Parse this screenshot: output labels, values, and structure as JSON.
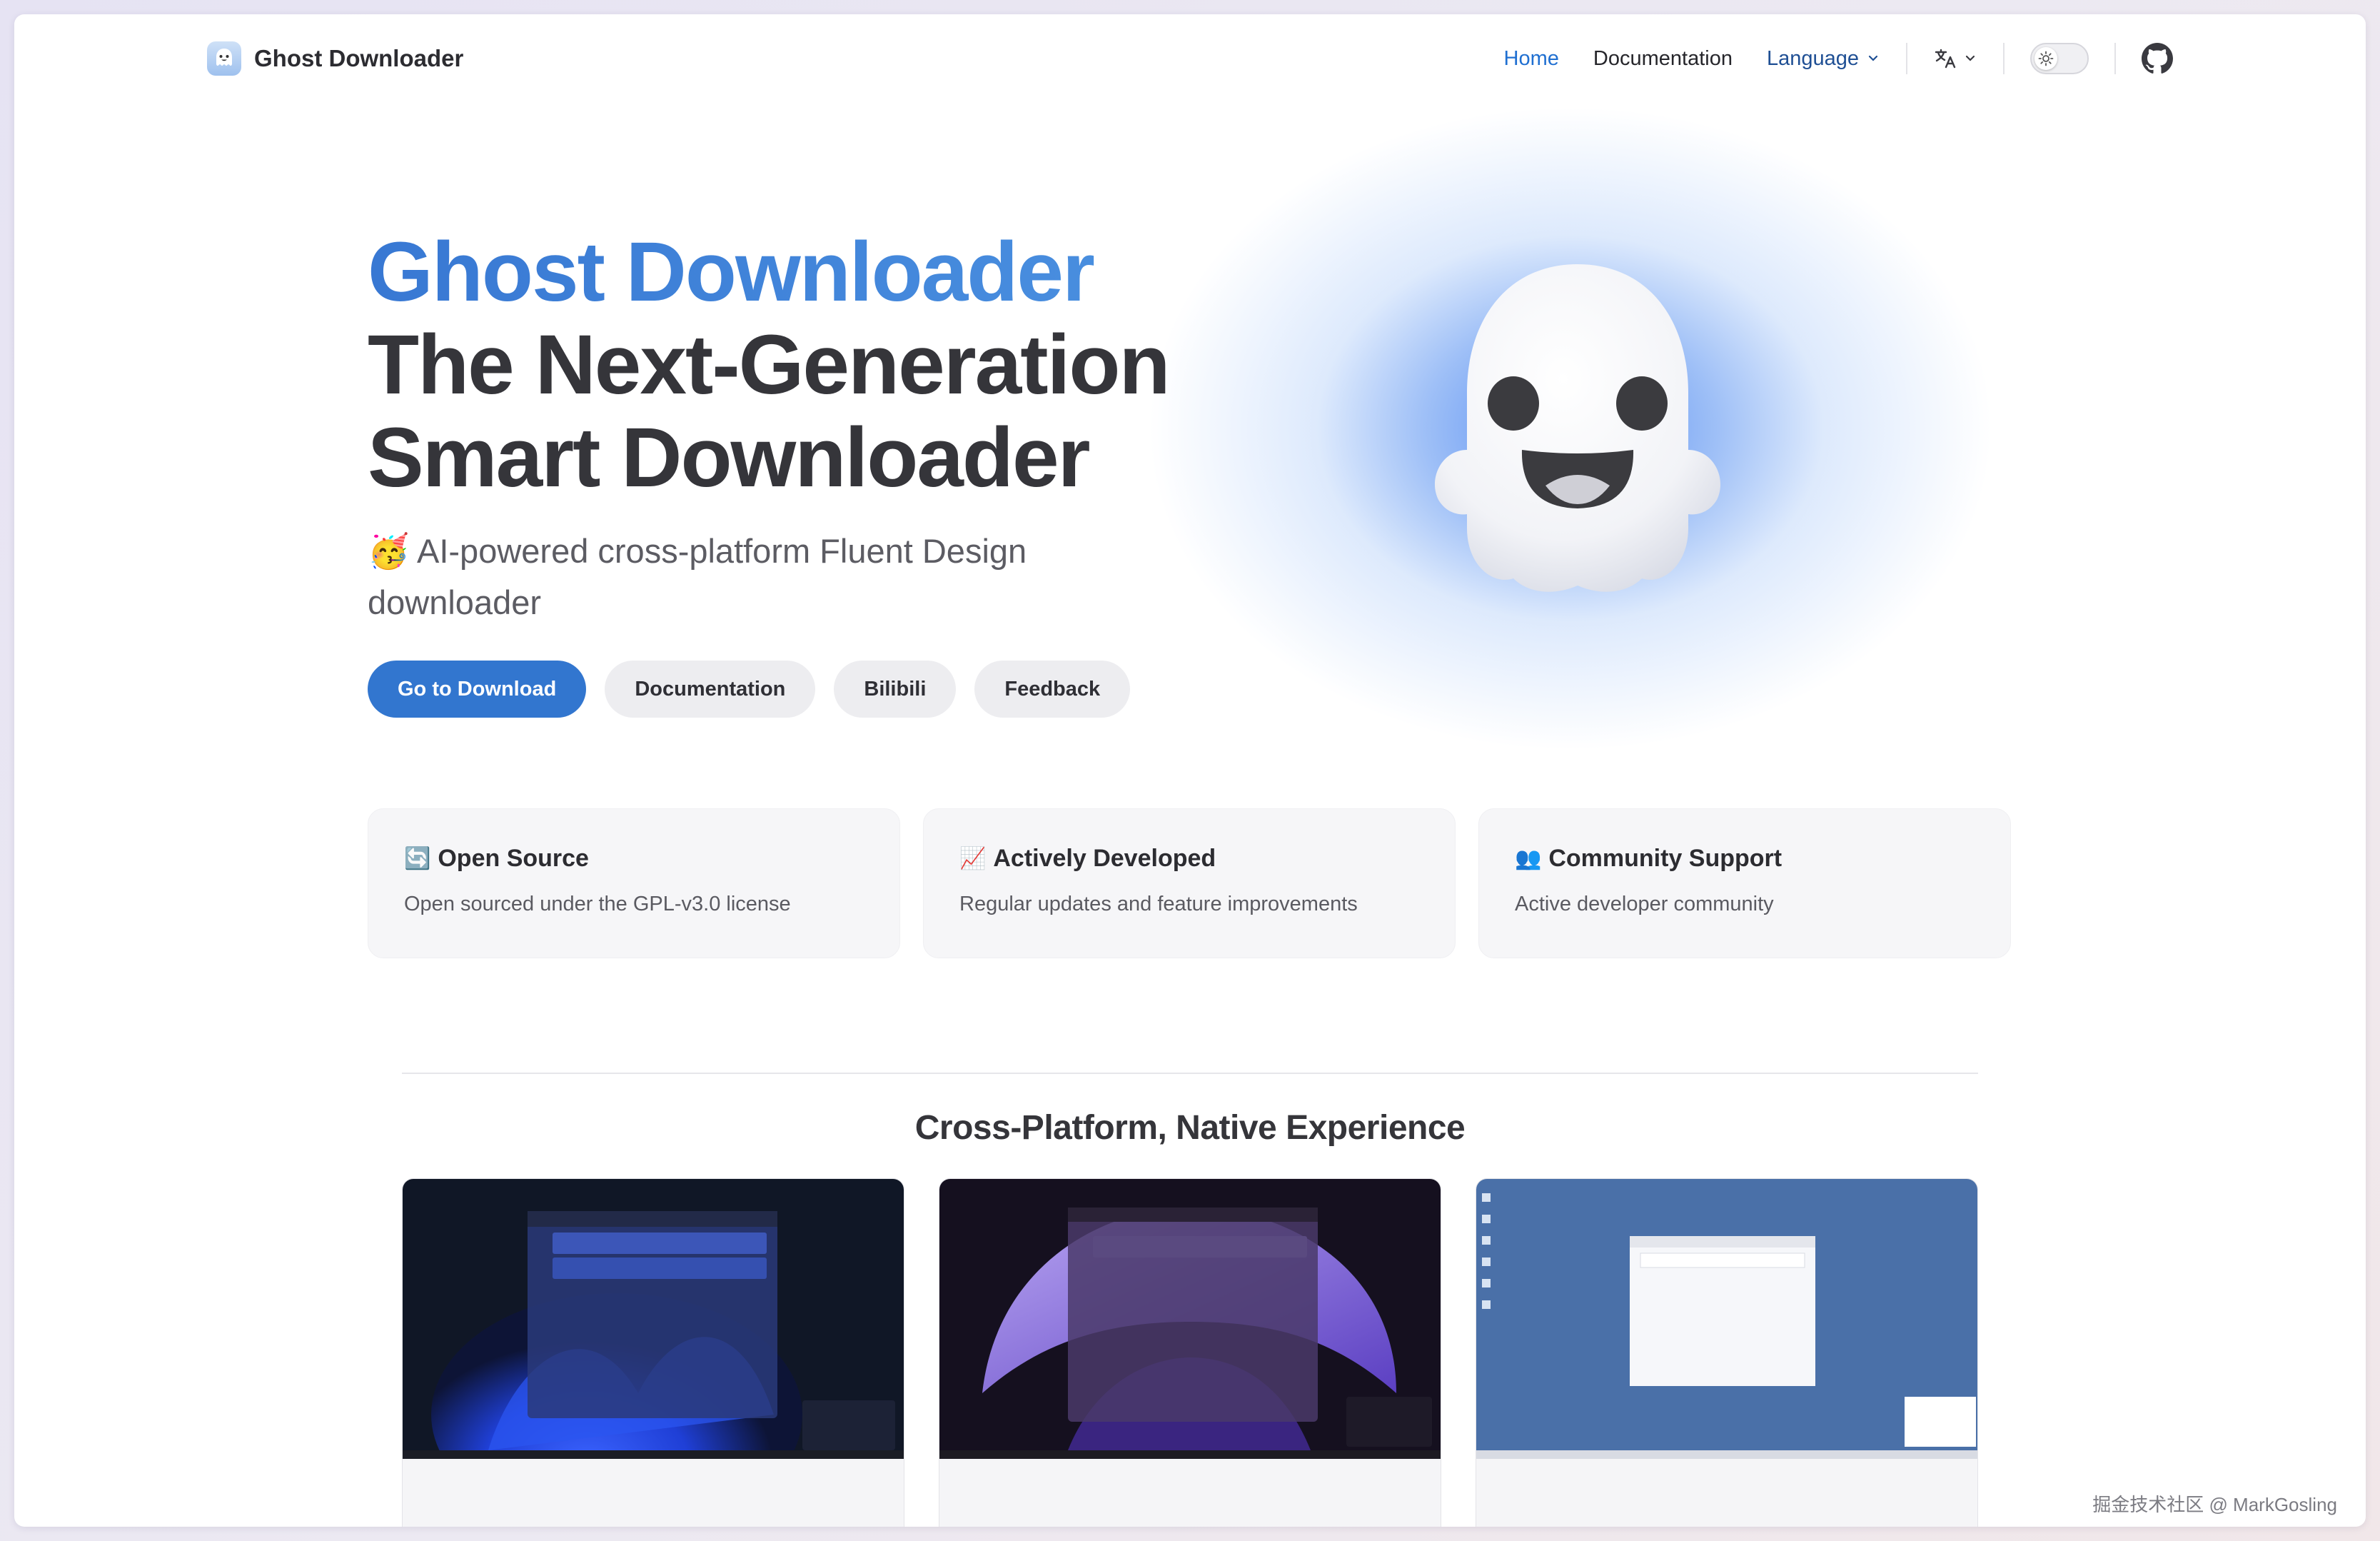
{
  "nav": {
    "brand": "Ghost Downloader",
    "links": [
      {
        "label": "Home",
        "active": true
      },
      {
        "label": "Documentation",
        "active": false
      },
      {
        "label": "Language",
        "active": false
      }
    ],
    "translate_icon": "translate-icon",
    "theme_toggle_icon": "sun-icon",
    "github_icon": "github-icon"
  },
  "hero": {
    "name": "Ghost Downloader",
    "line2": "The Next-Generation",
    "line3": "Smart Downloader",
    "tagline_emoji": "🥳",
    "tagline": "AI-powered cross-platform Fluent Design downloader",
    "buttons": {
      "download": "Go to Download",
      "docs": "Documentation",
      "bilibili": "Bilibili",
      "feedback": "Feedback"
    },
    "accent_color": "#3276cf"
  },
  "features": [
    {
      "emoji": "🔄",
      "title": "Open Source",
      "desc": "Open sourced under the GPL-v3.0 license"
    },
    {
      "emoji": "📈",
      "title": "Actively Developed",
      "desc": "Regular updates and feature improvements"
    },
    {
      "emoji": "👥",
      "title": "Community Support",
      "desc": "Active developer community"
    }
  ],
  "section": {
    "title": "Cross-Platform, Native Experience"
  },
  "screenshots": [
    {
      "name": "windows-11-screenshot"
    },
    {
      "name": "windows-purple-screenshot"
    },
    {
      "name": "linux-desktop-screenshot"
    }
  ],
  "watermark": "掘金技术社区 @ MarkGosling"
}
